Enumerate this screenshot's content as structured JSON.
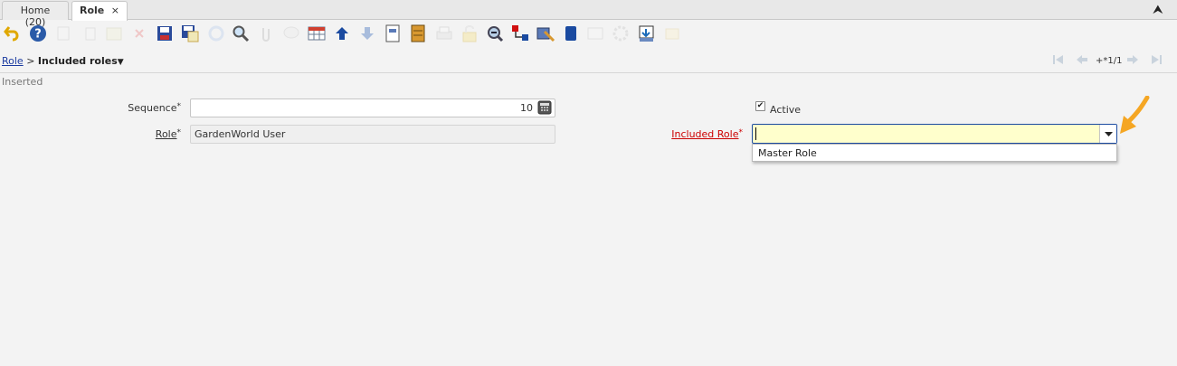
{
  "tabs": [
    {
      "label": "Home (20)"
    },
    {
      "label": "Role",
      "close": "×"
    }
  ],
  "collapse_glyph": "⮝",
  "toolbar": {
    "icons": [
      "undo-icon",
      "help-icon",
      "new-record-icon",
      "copy-record-icon",
      "delete-icon",
      "delete-disabled-icon",
      "save-icon",
      "save-create-icon",
      "refresh-icon",
      "find-icon",
      "attachment-icon",
      "chat-icon",
      "grid-toggle-icon",
      "previous-record-icon",
      "next-record-icon",
      "report-icon",
      "archive-icon",
      "print-icon",
      "lock-icon",
      "zoom-across-icon",
      "active-workflows-icon",
      "requests-icon",
      "product-info-icon",
      "export-icon",
      "run-process-icon",
      "customize-icon",
      "postit-icon",
      "import-icon",
      "quick-form-icon"
    ]
  },
  "breadcrumb": {
    "parent": "Role",
    "separator": ">",
    "current": "Included roles",
    "caret": "▼"
  },
  "navigation": {
    "record_indicator": "+*1/1"
  },
  "status": "Inserted",
  "form": {
    "sequence": {
      "label": "Sequence",
      "required_mark": "*",
      "value": "10"
    },
    "role": {
      "label": "Role",
      "required_mark": "*",
      "value": "GardenWorld User"
    },
    "active": {
      "label": "Active",
      "checked": true,
      "check_glyph": "✔"
    },
    "included_role": {
      "label": "Included Role",
      "required_mark": "*",
      "value": "",
      "options": [
        "Master Role"
      ]
    }
  },
  "colors": {
    "link": "#1a3aa0",
    "required_error": "#cc0000",
    "combo_focus_bg": "#ffffcc",
    "arrow_annotation": "#f5a623"
  }
}
